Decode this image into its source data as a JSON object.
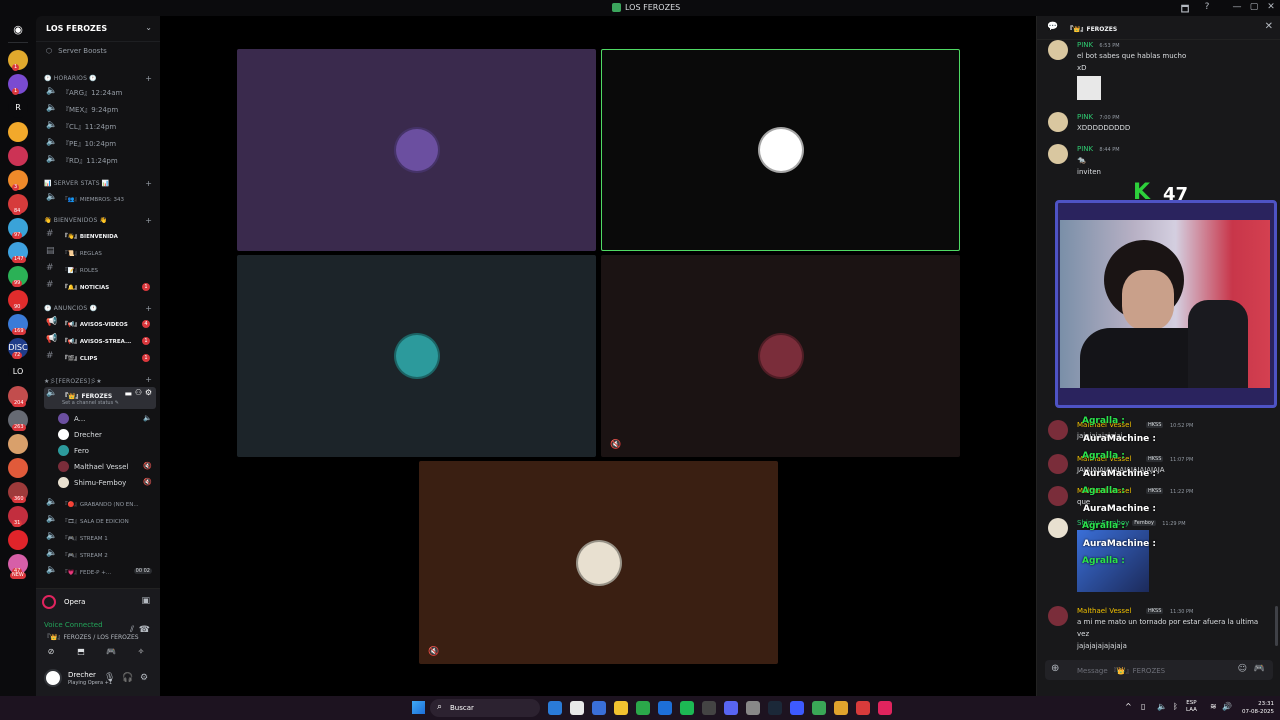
{
  "window": {
    "title": "LOS FEROZES",
    "controls": [
      "🗖",
      "?",
      "—",
      "▢",
      "✕"
    ]
  },
  "servers": [
    {
      "label": "",
      "color": "#e0a92d",
      "badge": "1"
    },
    {
      "label": "",
      "color": "#7a4bd1",
      "badge": "1"
    },
    {
      "label": "R",
      "color": "#0b0b0d",
      "badge": ""
    },
    {
      "label": "",
      "color": "#f2a92b",
      "badge": ""
    },
    {
      "label": "",
      "color": "#cc3355",
      "badge": ""
    },
    {
      "label": "",
      "color": "#ef8a2a",
      "badge": "3"
    },
    {
      "label": "",
      "color": "#d63b3b",
      "badge": "84"
    },
    {
      "label": "",
      "color": "#3aa3d8",
      "badge": "97"
    },
    {
      "label": "",
      "color": "#3fa2e0",
      "badge": "147"
    },
    {
      "label": "",
      "color": "#2bb156",
      "badge": "99"
    },
    {
      "label": "",
      "color": "#e02c2c",
      "badge": "90"
    },
    {
      "label": "",
      "color": "#3b7bd8",
      "badge": "169"
    },
    {
      "label": "DISC",
      "color": "#1f3c8a",
      "badge": "72"
    },
    {
      "label": "LO",
      "color": "#0b0b0d",
      "badge": ""
    },
    {
      "label": "",
      "color": "#c24d4d",
      "badge": "204"
    },
    {
      "label": "",
      "color": "#666a73",
      "badge": "263"
    },
    {
      "label": "",
      "color": "#d9a06b",
      "badge": ""
    },
    {
      "label": "",
      "color": "#e05a3a",
      "badge": ""
    },
    {
      "label": "",
      "color": "#9e3a3a",
      "badge": "360"
    },
    {
      "label": "",
      "color": "#c22e3e",
      "badge": "31"
    },
    {
      "label": "",
      "color": "#e0242a",
      "badge": ""
    },
    {
      "label": "",
      "color": "#d65fa8",
      "badge": "47"
    }
  ],
  "servers_new": "NEW",
  "guild": {
    "name": "LOS FEROZES",
    "boosts": "Server Boosts"
  },
  "categories": {
    "horarios": "🕐 HORARIOS 🕐",
    "stats": "📊 SERVER STATS 📊",
    "bienvenidos": "👋 BIENVENIDOS 👋",
    "anuncios": "🕐 ANUNCIOS 🕐",
    "ferozes": "★彡[FEROZES]彡★"
  },
  "channels_horarios": [
    {
      "name": "『ARG』12:24am"
    },
    {
      "name": "『MEX』9:24pm"
    },
    {
      "name": "『CL』11:24pm"
    },
    {
      "name": "『PE』10:24pm"
    },
    {
      "name": "『RD』11:24pm"
    }
  ],
  "channel_miembros": "『👥』MIEMBROS: 343",
  "channels_bienvenidos": [
    {
      "icon": "#",
      "name": "『👋』BIENVENIDA",
      "bold": true,
      "badge": ""
    },
    {
      "icon": "▤",
      "name": "『📜』REGLAS",
      "bold": false,
      "badge": ""
    },
    {
      "icon": "#",
      "name": "『📝』ROLES",
      "bold": false,
      "badge": ""
    },
    {
      "icon": "#",
      "name": "『🔔』NOTICIAS",
      "bold": true,
      "badge": "1"
    }
  ],
  "channels_anuncios": [
    {
      "icon": "📢",
      "name": "『📢』AVISOS-VIDEOS",
      "badge": "4"
    },
    {
      "icon": "📢",
      "name": "『📢』AVISOS-STREA...",
      "badge": "1"
    },
    {
      "icon": "#",
      "name": "『🎬』CLIPS",
      "badge": "1"
    }
  ],
  "channel_ferozes": {
    "name": "『👑』FEROZES",
    "status": "Set a channel status ✎"
  },
  "voice_users": [
    {
      "name": "A...",
      "color": "#6b4fa0",
      "trail": "🔈"
    },
    {
      "name": "Drecher",
      "color": "#ffffff",
      "trail": ""
    },
    {
      "name": "Fero",
      "color": "#2c9a9c",
      "trail": ""
    },
    {
      "name": "Malthael Vessel",
      "color": "#7a2d3a",
      "trail": "🔇"
    },
    {
      "name": "Shimu-Femboy",
      "color": "#e8e0d0",
      "trail": "🔇"
    }
  ],
  "channels_extra": [
    {
      "name": "『🔴』GRABANDO (NO EN..."
    },
    {
      "name": "『🎞』SALA DE EDICION"
    },
    {
      "name": "『🎮』STREAM 1"
    },
    {
      "name": "『🎮』STREAM 2"
    },
    {
      "name": "『💗』FEDE-P +...",
      "tag": "00 02"
    }
  ],
  "panel": {
    "activity": "Opera",
    "voice_status": "Voice Connected",
    "voice_channel": "『👑』FEROZES / LOS FEROZES",
    "user_name": "Drecher",
    "user_status": "Playing Opera +1"
  },
  "tiles": [
    {
      "bg": "#3a2a4d",
      "pfp": "#6b4fa0",
      "border": "#3a2a4d",
      "muted": false
    },
    {
      "bg": "#0a0a0a",
      "pfp": "#ffffff",
      "border": "#4fd964",
      "muted": false
    },
    {
      "bg": "#1c2429",
      "pfp": "#2c9a9c",
      "border": "#1c2429",
      "muted": false
    },
    {
      "bg": "#1b1313",
      "pfp": "#7a2d3a",
      "border": "#1b1313",
      "muted": true
    },
    {
      "bg": "#3a1f12",
      "pfp": "#e8e0d0",
      "border": "#3a1f12",
      "muted": true
    }
  ],
  "chat": {
    "header": "『👑』FEROZES",
    "messages": [
      {
        "user": "PINK",
        "time": "6:53 PM",
        "lines": [
          "el bot sabes que hablas mucho",
          "xD"
        ],
        "color": "#2ecc71"
      },
      {
        "user": "PINK",
        "time": "7:00 PM",
        "lines": [
          "XDDDDDDDDD"
        ],
        "color": "#2ecc71"
      },
      {
        "user": "PINK",
        "time": "8:44 PM",
        "lines": [
          "🐀",
          "inviten"
        ],
        "color": "#2ecc71"
      },
      {
        "user": "Malthael Vessel",
        "time": "10:52 PM",
        "lines": [
          "jajajajajajajaj"
        ],
        "color": "#f0c000"
      },
      {
        "user": "Malthael Vessel",
        "time": "11:07 PM",
        "lines": [
          "JAJAJAJAJAJAJAJAJAJAJAJAJA"
        ],
        "color": "#f0c000"
      },
      {
        "user": "Malthael Vessel",
        "time": "11:22 PM",
        "lines": [
          "que"
        ],
        "color": "#f0c000"
      },
      {
        "user": "Shimu-Femboy",
        "time": "11:29 PM",
        "lines": [],
        "color": "#2ecc71"
      },
      {
        "user": "Malthael Vessel",
        "time": "11:30 PM",
        "lines": [
          "a mi me mato un tornado por estar afuera la ultima",
          "vez",
          "jajajajajajajaja"
        ],
        "color": "#f0c000"
      }
    ],
    "tags": {
      "hkss": "HKSS",
      "femboy": "Femboy"
    },
    "input_placeholder": "Message 『👑』FEROZES"
  },
  "overlay": {
    "logo": "K",
    "viewers": "47",
    "lines": [
      {
        "name": "Agralla :",
        "kind": "name"
      },
      {
        "name": "AuraMachine :",
        "kind": "text"
      },
      {
        "name": "Agralla :",
        "kind": "name"
      },
      {
        "name": "AuraMachine :",
        "kind": "text"
      },
      {
        "name": "Agralla :",
        "kind": "name"
      },
      {
        "name": "AuraMachine :",
        "kind": "text"
      },
      {
        "name": "Agralla :",
        "kind": "name"
      },
      {
        "name": "AuraMachine :",
        "kind": "text"
      },
      {
        "name": "Agralla :",
        "kind": "name"
      }
    ]
  },
  "taskbar": {
    "search_placeholder": "Buscar",
    "lang": [
      "ESP",
      "LAA"
    ],
    "time": "23:31",
    "date": "07-08-2025",
    "apps": [
      "#2a7bd8",
      "#e8e8e8",
      "#3a6fd8",
      "#f2c230",
      "#2ba84a",
      "#1d6fd8",
      "#1db954",
      "#444",
      "#5865f2",
      "#888",
      "#1b2838",
      "#3d5afe",
      "#3aa757",
      "#e0a32d",
      "#d83b3b",
      "#e0245e"
    ]
  }
}
